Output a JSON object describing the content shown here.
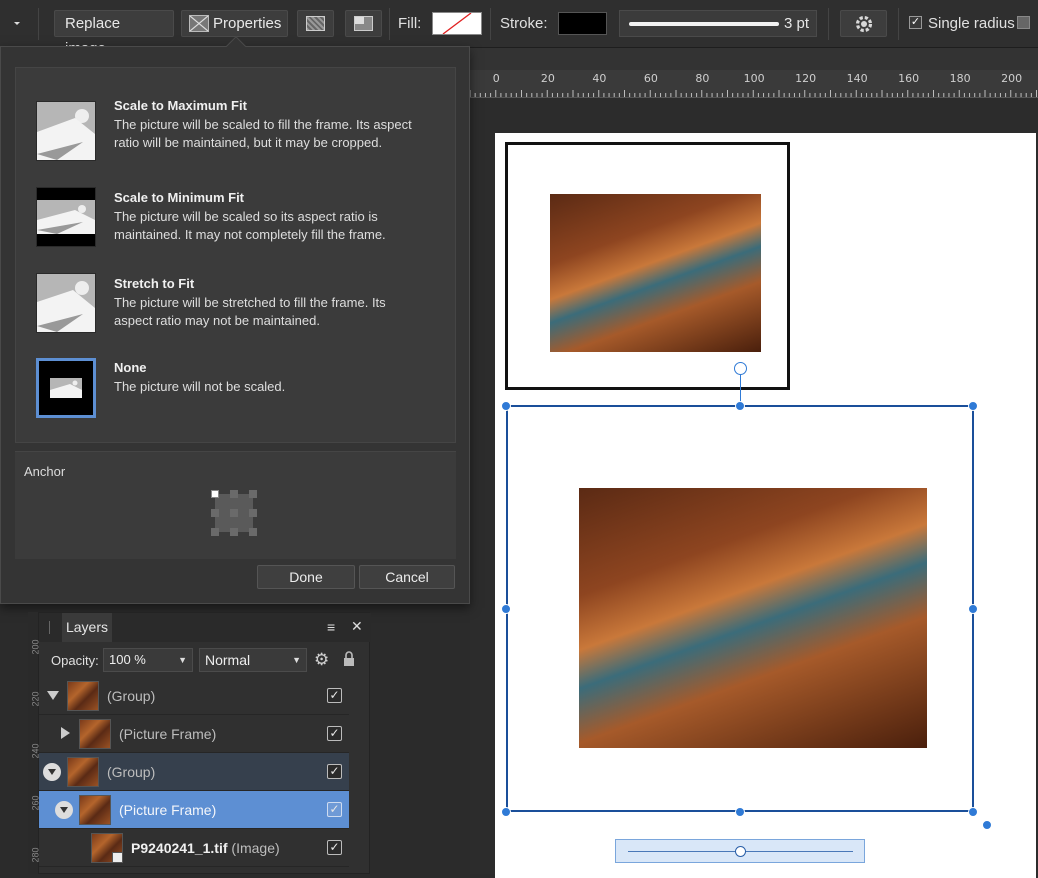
{
  "toolbar": {
    "replace_image": "Replace image",
    "properties": "Properties",
    "fill_label": "Fill:",
    "stroke_label": "Stroke:",
    "stroke_width": "3 pt",
    "single_radius": "Single radius"
  },
  "ruler": {
    "ticks": [
      "0",
      "20",
      "40",
      "60",
      "80",
      "100",
      "120",
      "140",
      "160",
      "180",
      "200"
    ]
  },
  "scaling_options": [
    {
      "title": "Scale to Maximum Fit",
      "desc": "The picture will be scaled to fill the frame. Its aspect ratio will be maintained, but it may be cropped.",
      "selected": false
    },
    {
      "title": "Scale to Minimum Fit",
      "desc": "The picture will be scaled so its aspect ratio is maintained. It may not completely fill the frame.",
      "selected": false
    },
    {
      "title": "Stretch to Fit",
      "desc": "The picture will be stretched to fill the frame. Its aspect ratio may not be maintained.",
      "selected": false
    },
    {
      "title": "None",
      "desc": "The picture will not be scaled.",
      "selected": true
    }
  ],
  "anchor": {
    "label": "Anchor"
  },
  "dialog": {
    "done": "Done",
    "cancel": "Cancel"
  },
  "layers": {
    "tab": "Layers",
    "opacity_label": "Opacity:",
    "opacity_value": "100 %",
    "blend_mode": "Normal",
    "rows": [
      {
        "name": "(Group)",
        "suffix": ""
      },
      {
        "name": "(Picture Frame)",
        "suffix": ""
      },
      {
        "name": "(Group)",
        "suffix": ""
      },
      {
        "name": "(Picture Frame)",
        "suffix": ""
      },
      {
        "name": "P9240241_1.tif",
        "suffix": "(Image)"
      }
    ],
    "side_ruler": [
      "200",
      "220",
      "240",
      "260",
      "280"
    ]
  },
  "colors": {
    "accent": "#2f7ad6",
    "selected_row": "#5d8fd3",
    "panel": "#343434"
  }
}
